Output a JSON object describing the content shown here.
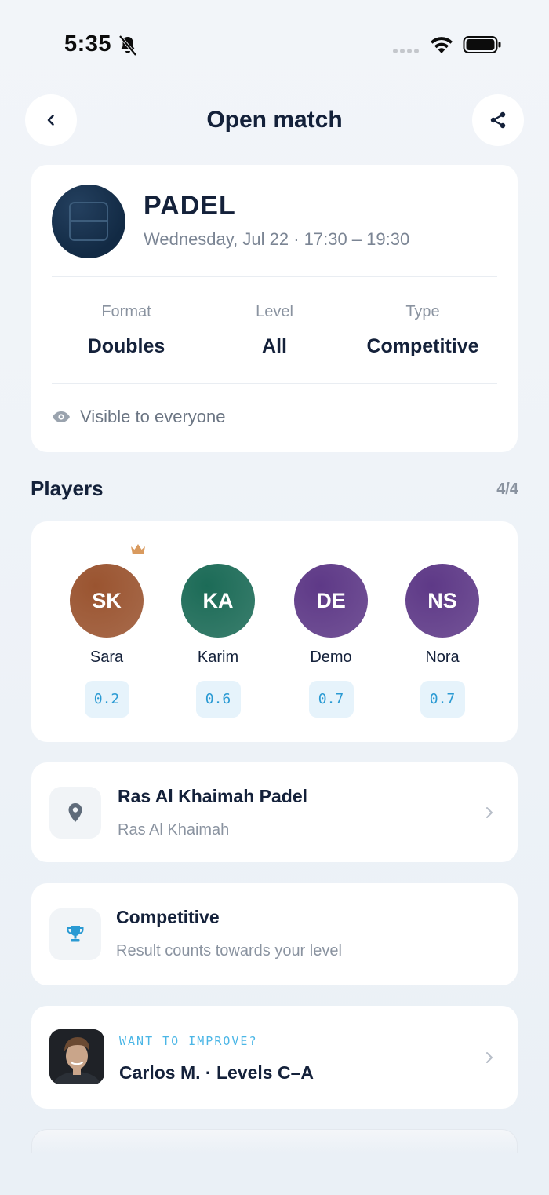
{
  "status_bar": {
    "time": "5:35"
  },
  "header": {
    "title": "Open match"
  },
  "match": {
    "sport": "PADEL",
    "date_time": "Wednesday, Jul 22 · 17:30 – 19:30",
    "stats": [
      {
        "label": "Format",
        "value": "Doubles"
      },
      {
        "label": "Level",
        "value": "All"
      },
      {
        "label": "Type",
        "value": "Competitive"
      }
    ],
    "visibility": "Visible to everyone"
  },
  "players_section": {
    "title": "Players",
    "count": "4/4",
    "players": [
      {
        "initials": "SK",
        "name": "Sara",
        "level": "0.2",
        "color": "#9a5430"
      },
      {
        "initials": "KA",
        "name": "Karim",
        "level": "0.6",
        "color": "#1c6b57"
      },
      {
        "initials": "DE",
        "name": "Demo",
        "level": "0.7",
        "color": "#5e3987"
      },
      {
        "initials": "NS",
        "name": "Nora",
        "level": "0.7",
        "color": "#5e3987"
      }
    ]
  },
  "venue": {
    "title": "Ras Al Khaimah Padel",
    "subtitle": "Ras Al Khaimah"
  },
  "match_type": {
    "title": "Competitive",
    "subtitle": "Result counts towards your level"
  },
  "coach": {
    "kicker": "WANT TO IMPROVE?",
    "name": "Carlos M. · Levels C–A"
  },
  "colors": {
    "accent": "#2a9ad3",
    "crown": "#d99a5e"
  }
}
